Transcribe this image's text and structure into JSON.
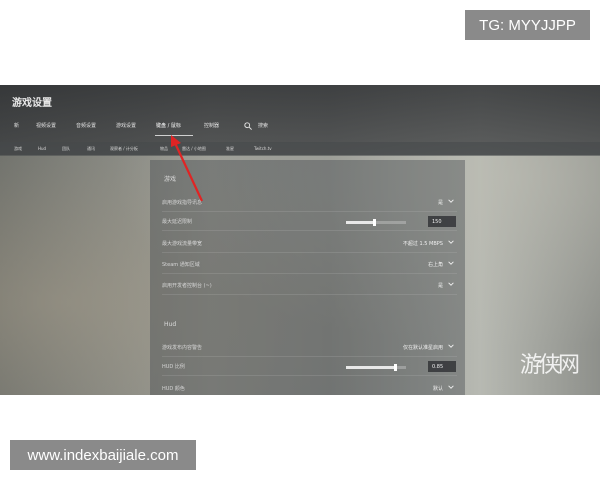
{
  "overlay": {
    "tg_label": "TG: MYYJJPP",
    "url_label": "www.indexbaijiale.com"
  },
  "app": {
    "title": "游戏设置"
  },
  "tabs": [
    {
      "label": "新"
    },
    {
      "label": "视频设置"
    },
    {
      "label": "音频设置"
    },
    {
      "label": "游戏设置"
    },
    {
      "label": "键盘 / 鼠标",
      "active": true
    },
    {
      "label": "控制器"
    },
    {
      "label": "搜索"
    }
  ],
  "subtabs": [
    {
      "label": "游戏"
    },
    {
      "label": "Hud"
    },
    {
      "label": "团队"
    },
    {
      "label": "通讯"
    },
    {
      "label": "观察者 / 计分板"
    },
    {
      "label": "物品"
    },
    {
      "label": "雷达 / 小地图"
    },
    {
      "label": "准星"
    },
    {
      "label": "Twitch.tv"
    }
  ],
  "sections": {
    "game": {
      "title": "游戏",
      "rows": [
        {
          "label": "启用游戏指导讯息",
          "value": "是"
        },
        {
          "label": "最大延迟限制",
          "value": "150",
          "slider_fraction": 0.47
        },
        {
          "label": "最大游戏流量带宽",
          "value": "不超过 1.5 MBPS"
        },
        {
          "label": "Steam 通知区域",
          "value": "右上角"
        },
        {
          "label": "启用开发者控制台 (~)",
          "value": "是"
        }
      ]
    },
    "hud": {
      "title": "Hud",
      "rows": [
        {
          "label": "游戏发布内容警告",
          "value": "仅在默认准星启用"
        },
        {
          "label": "HUD 比例",
          "value": "0.85",
          "slider_fraction": 0.82
        },
        {
          "label": "HUD 颜色",
          "value": "默认"
        }
      ]
    }
  },
  "watermark": {
    "text": "游侠网"
  },
  "annotation": {
    "arrow_color": "#e02424"
  }
}
